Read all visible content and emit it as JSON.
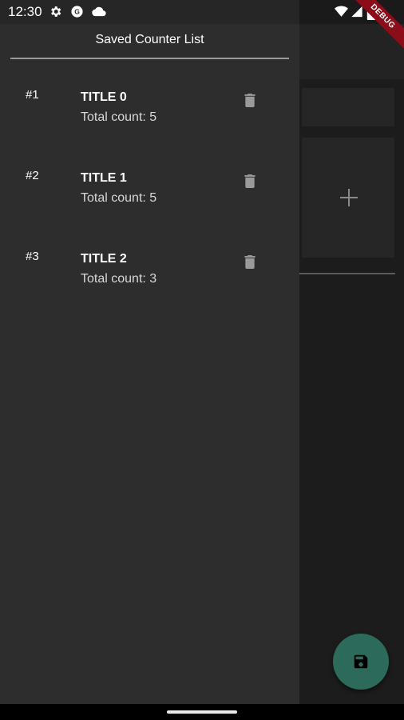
{
  "status_bar": {
    "time": "12:30",
    "debug_label": "DEBUG",
    "icons": [
      "settings-icon",
      "g-icon",
      "cloud-icon",
      "wifi-icon",
      "signal-icon",
      "battery-icon"
    ]
  },
  "drawer": {
    "title": "Saved Counter List",
    "items": [
      {
        "index": "#1",
        "title": "TITLE 0",
        "count": "Total count: 5"
      },
      {
        "index": "#2",
        "title": "TITLE 1",
        "count": "Total count: 5"
      },
      {
        "index": "#3",
        "title": "TITLE 2",
        "count": "Total count: 3"
      }
    ]
  },
  "background": {
    "add_icon": "plus-icon",
    "fab_icon": "save-icon"
  },
  "colors": {
    "drawer_bg": "#2d2d2d",
    "app_bg": "#1c1c1c",
    "fab": "#2c6a5b",
    "debug_ribbon": "#8b0d1a"
  }
}
